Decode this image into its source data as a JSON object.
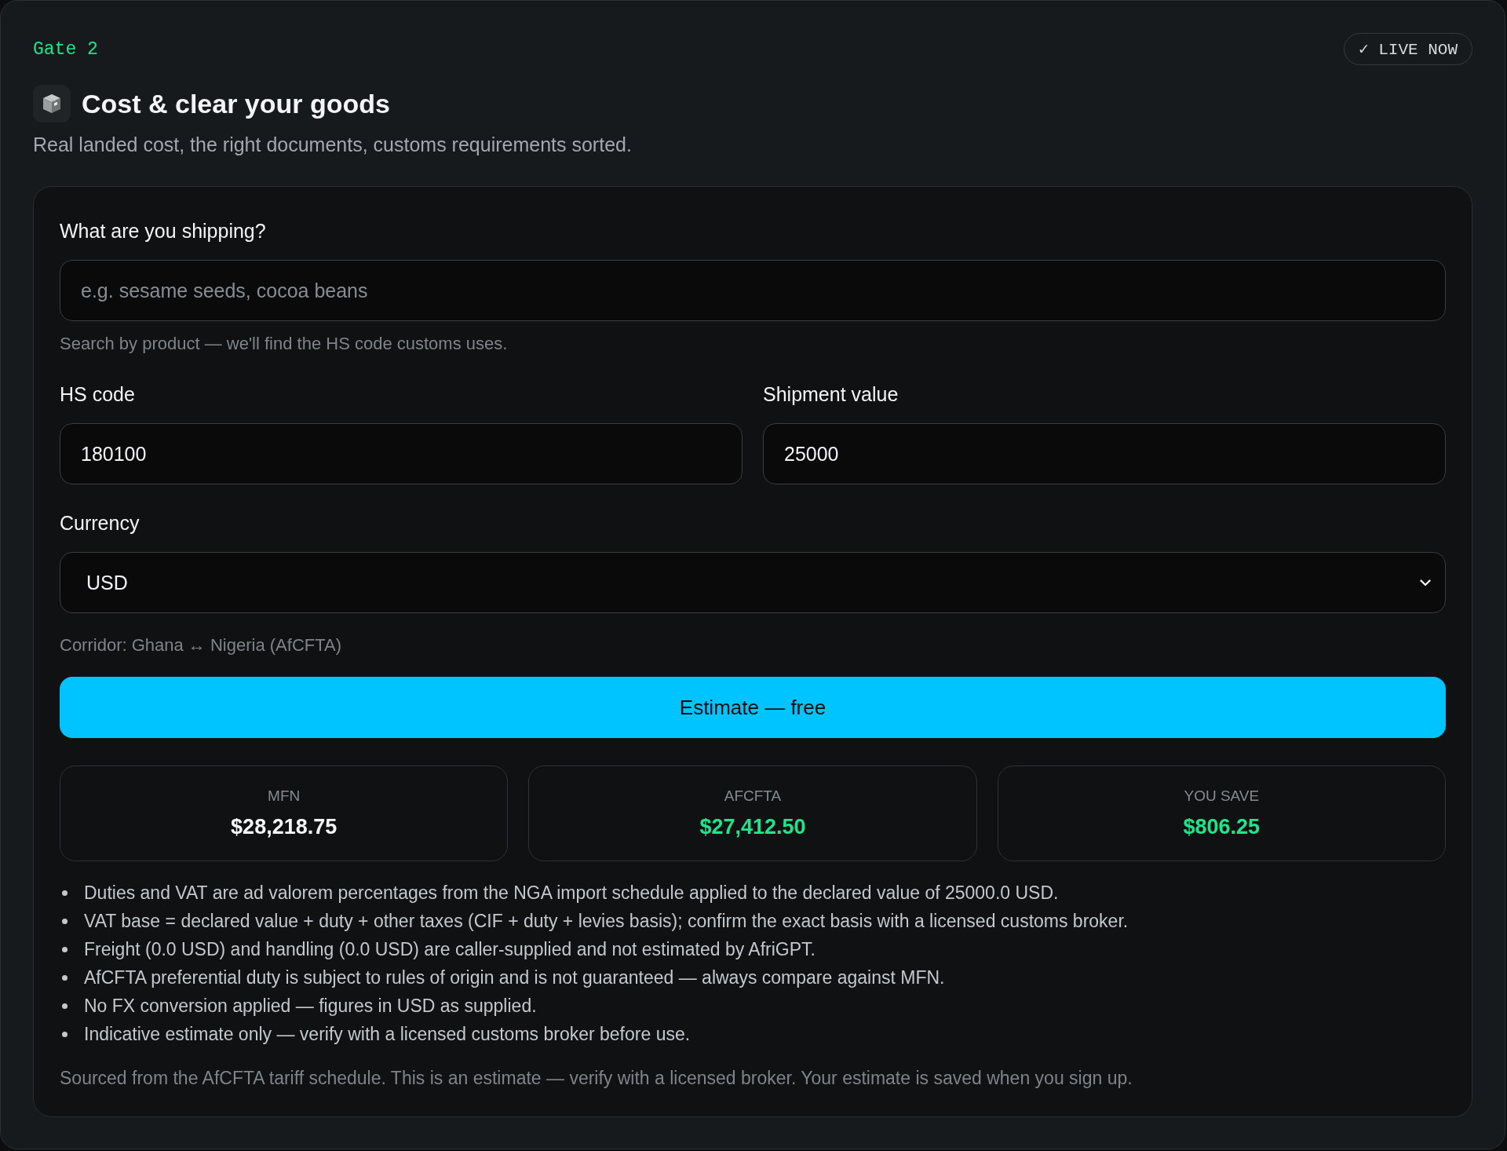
{
  "header": {
    "eyebrow": "Gate 2",
    "status_badge": "✓ LIVE NOW",
    "title": "Cost & clear your goods",
    "subtitle": "Real landed cost, the right documents, customs requirements sorted."
  },
  "form": {
    "product_field": {
      "label": "What are you shipping?",
      "placeholder": "e.g. sesame seeds, cocoa beans",
      "hint": "Search by product — we'll find the HS code customs uses."
    },
    "hs_code_field": {
      "label": "HS code",
      "value": "180100"
    },
    "shipment_value_field": {
      "label": "Shipment value",
      "value": "25000"
    },
    "currency_field": {
      "label": "Currency",
      "value": "USD"
    },
    "corridor_note": "Corridor: Ghana ↔ Nigeria (AfCFTA)",
    "submit_button": "Estimate — free"
  },
  "results": [
    {
      "label": "MFN",
      "value": "$28,218.75",
      "color": "#f4f5f6"
    },
    {
      "label": "AFCFTA",
      "value": "$27,412.50",
      "color": "#1ee58b"
    },
    {
      "label": "YOU SAVE",
      "value": "$806.25",
      "color": "#1ee58b"
    }
  ],
  "notes": [
    "Duties and VAT are ad valorem percentages from the NGA import schedule applied to the declared value of 25000.0 USD.",
    "VAT base = declared value + duty + other taxes (CIF + duty + levies basis); confirm the exact basis with a licensed customs broker.",
    "Freight (0.0 USD) and handling (0.0 USD) are caller-supplied and not estimated by AfriGPT.",
    "AfCFTA preferential duty is subject to rules of origin and is not guaranteed — always compare against MFN.",
    "No FX conversion applied — figures in USD as supplied.",
    "Indicative estimate only — verify with a licensed customs broker before use."
  ],
  "footnote": "Sourced from the AfCFTA tariff schedule. This is an estimate — verify with a licensed broker. Your estimate is saved when you sign up."
}
